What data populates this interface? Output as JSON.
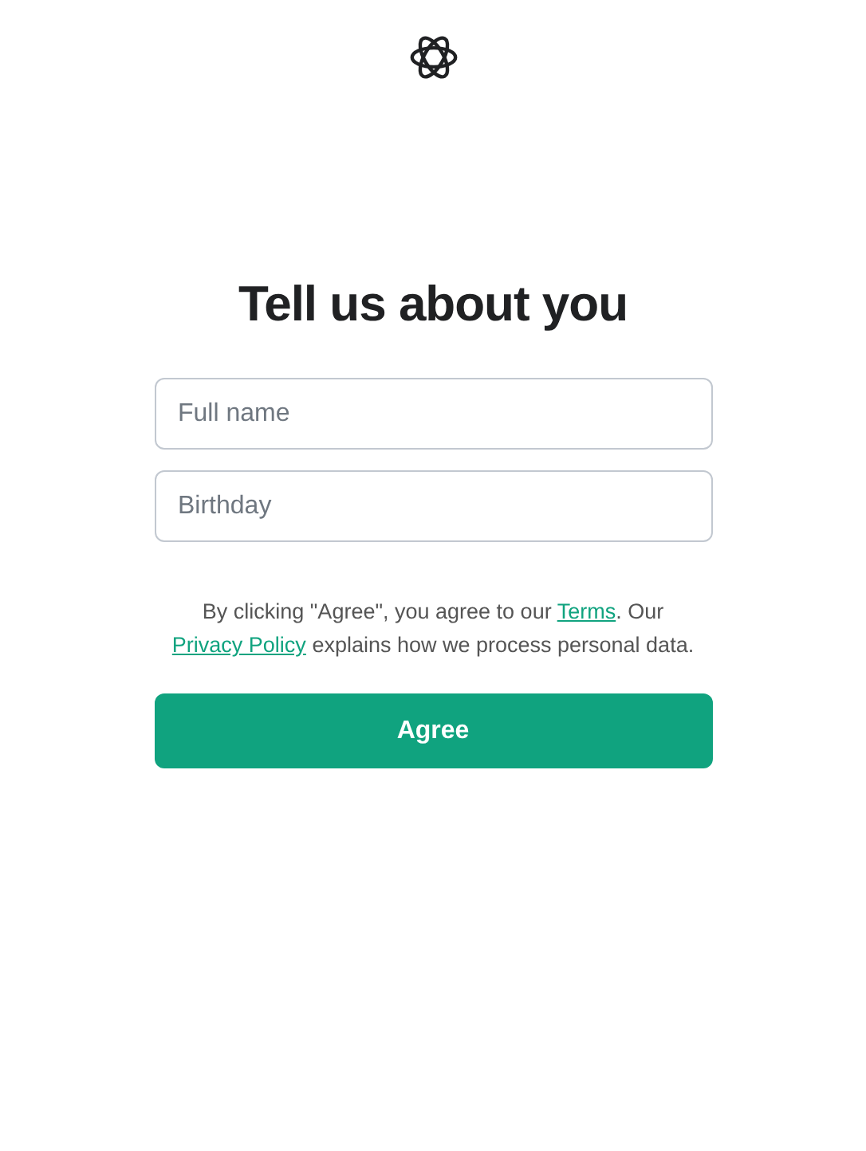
{
  "heading": "Tell us about you",
  "fields": [
    {
      "placeholder": "Full name"
    },
    {
      "placeholder": "Birthday"
    }
  ],
  "consent": [
    {
      "kind": "text",
      "text": "By clicking \"Agree\", you agree to our "
    },
    {
      "kind": "link",
      "text": "Terms"
    },
    {
      "kind": "text",
      "text": ". Our "
    },
    {
      "kind": "link",
      "text": "Privacy Policy"
    },
    {
      "kind": "text",
      "text": " explains how we process personal data."
    }
  ],
  "button": "Agree"
}
